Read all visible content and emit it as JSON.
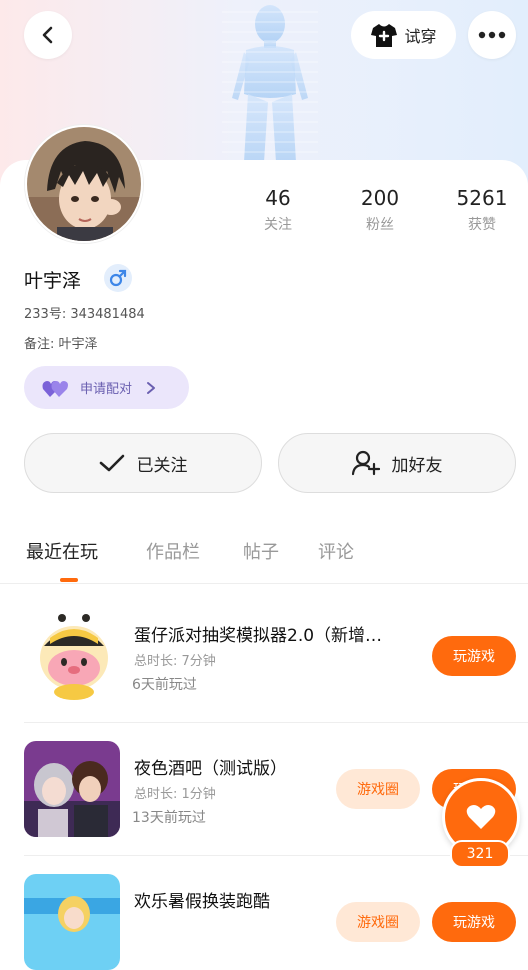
{
  "header": {
    "try_on_label": "试穿"
  },
  "profile": {
    "name": "叶宇泽",
    "id_line": "233号: 343481484",
    "remark_line": "备注: 叶宇泽",
    "match_label": "申请配对",
    "stats": [
      {
        "num": "46",
        "label": "关注"
      },
      {
        "num": "200",
        "label": "粉丝"
      },
      {
        "num": "5261",
        "label": "获赞"
      }
    ]
  },
  "actions": {
    "followed_label": "已关注",
    "add_friend_label": "加好友"
  },
  "tabs": [
    {
      "label": "最近在玩"
    },
    {
      "label": "作品栏"
    },
    {
      "label": "帖子"
    },
    {
      "label": "评论"
    }
  ],
  "games": [
    {
      "title": "蛋仔派对抽奖模拟器2.0（新增…",
      "duration": "总时长: 7分钟",
      "last": "6天前玩过",
      "play_label": "玩游戏"
    },
    {
      "title": "夜色酒吧（测试版）",
      "duration": "总时长: 1分钟",
      "last": "13天前玩过",
      "circle_label": "游戏圈",
      "play_label": "玩游戏"
    },
    {
      "title": "欢乐暑假换装跑酷",
      "circle_label": "游戏圈",
      "play_label": "玩游戏"
    }
  ],
  "like": {
    "count": "321"
  },
  "colors": {
    "accent": "#ff6a0d",
    "match_bg": "#ebe6fb",
    "gender_blue": "#3d86e8"
  }
}
